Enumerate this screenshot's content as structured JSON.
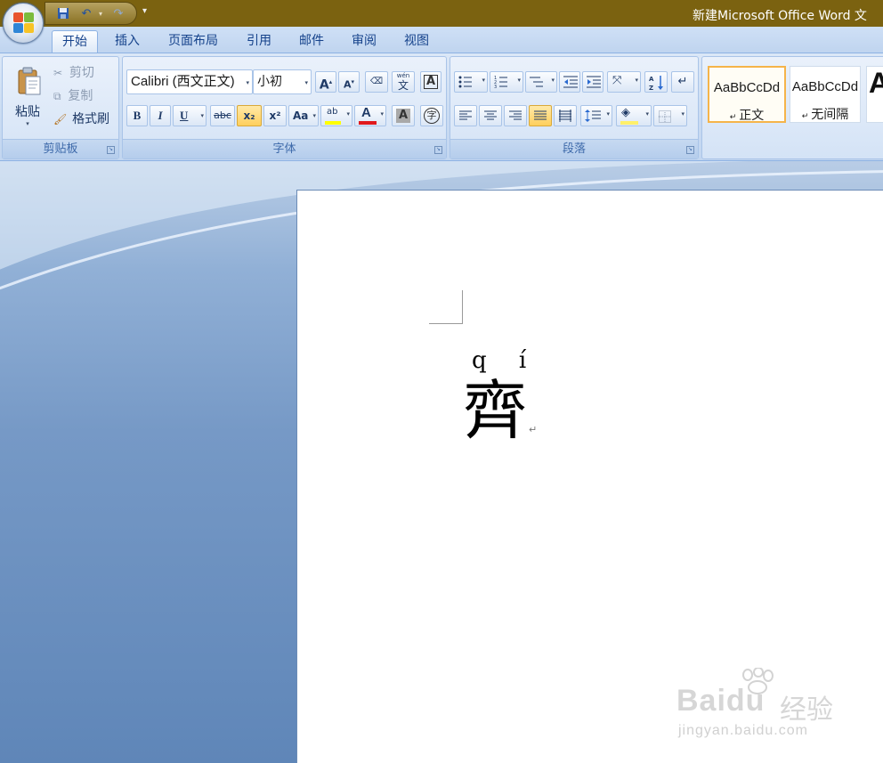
{
  "window": {
    "title": "新建Microsoft Office Word 文"
  },
  "quick_access": {
    "icons": [
      "save-icon",
      "undo-icon",
      "redo-icon",
      "customize-icon"
    ]
  },
  "tabs": [
    "开始",
    "插入",
    "页面布局",
    "引用",
    "邮件",
    "审阅",
    "视图"
  ],
  "active_tab": "开始",
  "clipboard": {
    "paste_label": "粘贴",
    "cut_label": "剪切",
    "copy_label": "复制",
    "format_painter_label": "格式刷",
    "group_label": "剪贴板"
  },
  "font": {
    "family": "Calibri (西文正文)",
    "size": "小初",
    "group_label": "字体",
    "bold": "B",
    "italic": "I",
    "underline": "U",
    "strike": "abc",
    "subscript": "x₂",
    "superscript": "x²",
    "change_case": "Aa",
    "grow": "A",
    "shrink": "A",
    "phonetic": "wén",
    "phonetic_char": "文",
    "border_char": "A",
    "highlight": "ab",
    "font_color_char": "A",
    "shading_char": "A",
    "enclose_char": "字"
  },
  "paragraph": {
    "group_label": "段落",
    "sort_icon": "sort-icon"
  },
  "styles": {
    "items": [
      {
        "sample": "AaBbCcDd",
        "name": "正文",
        "selected": true
      },
      {
        "sample": "AaBbCcDd",
        "name": "无间隔",
        "selected": false
      }
    ],
    "partial_sample": "A"
  },
  "document": {
    "pinyin": "qí",
    "pinyin_display": "q í",
    "character": "齊",
    "paragraph_mark": "↵"
  },
  "watermark": {
    "logo": "Baidu",
    "text": "经验",
    "url": "jingyan.baidu.com"
  },
  "colors": {
    "title_bar": "#7b6210",
    "ribbon": "#c9dbf2",
    "highlight_yellow": "#ffff00",
    "font_color_red": "#e0191d",
    "active_button": "#ffcf5c"
  }
}
